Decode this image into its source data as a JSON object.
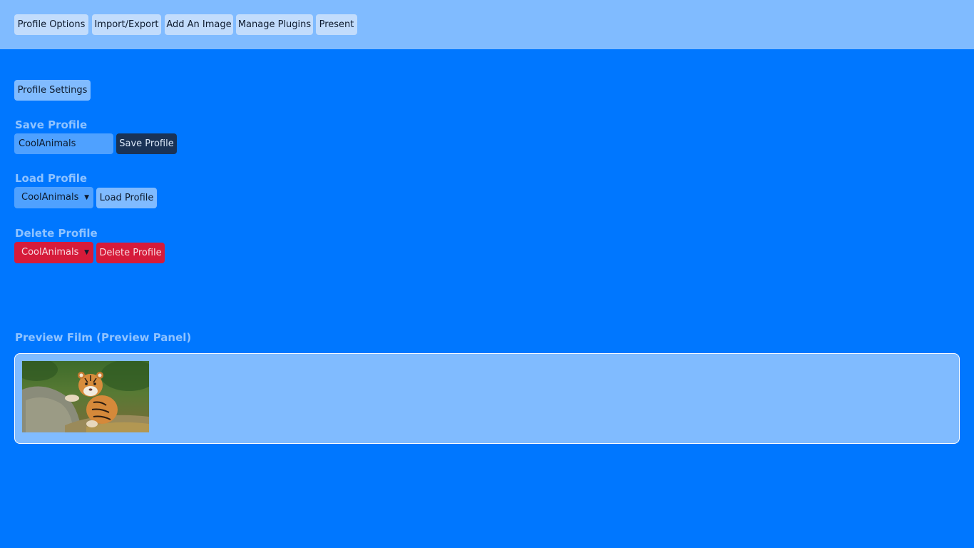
{
  "nav": {
    "items": [
      {
        "label": "Profile Options"
      },
      {
        "label": "Import/Export"
      },
      {
        "label": "Add An Image"
      },
      {
        "label": "Manage Plugins"
      },
      {
        "label": "Present"
      }
    ]
  },
  "profile_settings_label": "Profile Settings",
  "save": {
    "heading": "Save Profile",
    "input_value": "CoolAnimals",
    "button_label": "Save Profile"
  },
  "load": {
    "heading": "Load Profile",
    "selected": "CoolAnimals",
    "button_label": "Load Profile"
  },
  "delete": {
    "heading": "Delete Profile",
    "selected": "CoolAnimals",
    "button_label": "Delete Profile"
  },
  "preview": {
    "heading": "Preview Film (Preview Panel)",
    "thumbnail_icon": "tiger-cub-image"
  },
  "colors": {
    "background": "#0077ff",
    "topbar": "#80bbff",
    "danger": "#d61b3a",
    "dark_button": "#1a3356"
  }
}
